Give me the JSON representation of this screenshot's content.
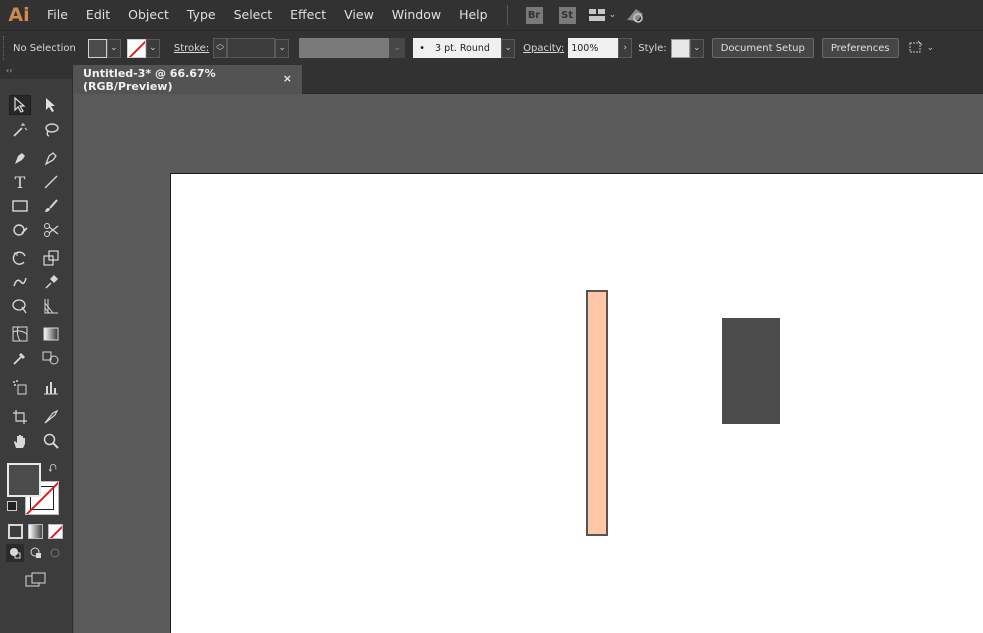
{
  "app": {
    "logo": "Ai"
  },
  "menu": [
    "File",
    "Edit",
    "Object",
    "Type",
    "Select",
    "Effect",
    "View",
    "Window",
    "Help"
  ],
  "app_buttons": [
    "Br",
    "St"
  ],
  "control_bar": {
    "selection_status": "No Selection",
    "stroke_label": "Stroke:",
    "brush_label": "3 pt. Round",
    "opacity_label": "Opacity:",
    "opacity_value": "100%",
    "style_label": "Style:",
    "document_setup": "Document Setup",
    "preferences": "Preferences"
  },
  "document": {
    "tab_title": "Untitled-3* @ 66.67% (RGB/Preview)",
    "close": "×"
  },
  "toolbox": {
    "collapse": "‹‹"
  },
  "colors": {
    "fill": "#4b4b4b",
    "shape_tall_fill": "#ffc7a8",
    "shape_tall_stroke": "#555555",
    "shape_dark_fill": "#4b4b4b",
    "accent_logo": "#d08a4e"
  }
}
